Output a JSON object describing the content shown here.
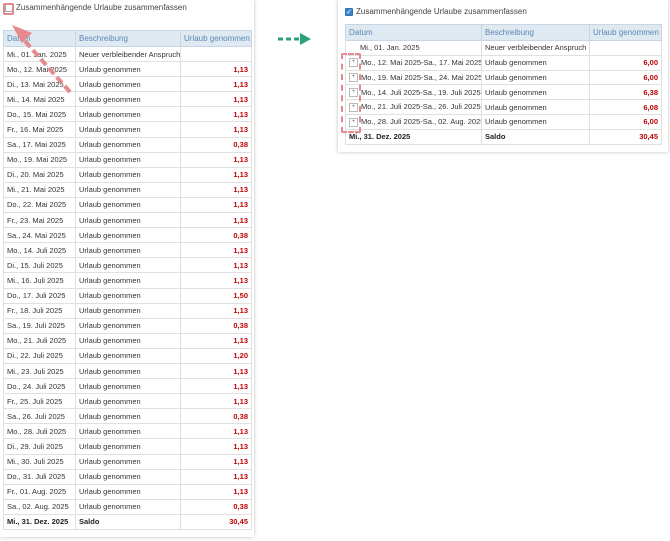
{
  "checkbox_label": "Zusammenhängende Urlaube zusammenfassen",
  "columns": {
    "date": "Datum",
    "description": "Beschreibung",
    "vacation": "Urlaub genommen"
  },
  "left_rows": [
    {
      "date": "Mi., 01. Jan. 2025",
      "desc": "Neuer verbleibender Anspruch",
      "value": ""
    },
    {
      "date": "Mo., 12. Mai 2025",
      "desc": "Urlaub genommen",
      "value": "1,13"
    },
    {
      "date": "Di., 13. Mai 2025",
      "desc": "Urlaub genommen",
      "value": "1,13"
    },
    {
      "date": "Mi., 14. Mai 2025",
      "desc": "Urlaub genommen",
      "value": "1,13"
    },
    {
      "date": "Do., 15. Mai 2025",
      "desc": "Urlaub genommen",
      "value": "1,13"
    },
    {
      "date": "Fr., 16. Mai 2025",
      "desc": "Urlaub genommen",
      "value": "1,13"
    },
    {
      "date": "Sa., 17. Mai 2025",
      "desc": "Urlaub genommen",
      "value": "0,38"
    },
    {
      "date": "Mo., 19. Mai 2025",
      "desc": "Urlaub genommen",
      "value": "1,13"
    },
    {
      "date": "Di., 20. Mai 2025",
      "desc": "Urlaub genommen",
      "value": "1,13"
    },
    {
      "date": "Mi., 21. Mai 2025",
      "desc": "Urlaub genommen",
      "value": "1,13"
    },
    {
      "date": "Do., 22. Mai 2025",
      "desc": "Urlaub genommen",
      "value": "1,13"
    },
    {
      "date": "Fr., 23. Mai 2025",
      "desc": "Urlaub genommen",
      "value": "1,13"
    },
    {
      "date": "Sa., 24. Mai 2025",
      "desc": "Urlaub genommen",
      "value": "0,38"
    },
    {
      "date": "Mo., 14. Juli 2025",
      "desc": "Urlaub genommen",
      "value": "1,13"
    },
    {
      "date": "Di., 15. Juli 2025",
      "desc": "Urlaub genommen",
      "value": "1,13"
    },
    {
      "date": "Mi., 16. Juli 2025",
      "desc": "Urlaub genommen",
      "value": "1,13"
    },
    {
      "date": "Do., 17. Juli 2025",
      "desc": "Urlaub genommen",
      "value": "1,50"
    },
    {
      "date": "Fr., 18. Juli 2025",
      "desc": "Urlaub genommen",
      "value": "1,13"
    },
    {
      "date": "Sa., 19. Juli 2025",
      "desc": "Urlaub genommen",
      "value": "0,38"
    },
    {
      "date": "Mo., 21. Juli 2025",
      "desc": "Urlaub genommen",
      "value": "1,13"
    },
    {
      "date": "Di., 22. Juli 2025",
      "desc": "Urlaub genommen",
      "value": "1,20"
    },
    {
      "date": "Mi., 23. Juli 2025",
      "desc": "Urlaub genommen",
      "value": "1,13"
    },
    {
      "date": "Do., 24. Juli 2025",
      "desc": "Urlaub genommen",
      "value": "1,13"
    },
    {
      "date": "Fr., 25. Juli 2025",
      "desc": "Urlaub genommen",
      "value": "1,13"
    },
    {
      "date": "Sa., 26. Juli 2025",
      "desc": "Urlaub genommen",
      "value": "0,38"
    },
    {
      "date": "Mo., 28. Juli 2025",
      "desc": "Urlaub genommen",
      "value": "1,13"
    },
    {
      "date": "Di., 29. Juli 2025",
      "desc": "Urlaub genommen",
      "value": "1,13"
    },
    {
      "date": "Mi., 30. Juli 2025",
      "desc": "Urlaub genommen",
      "value": "1,13"
    },
    {
      "date": "Do., 31. Juli 2025",
      "desc": "Urlaub genommen",
      "value": "1,13"
    },
    {
      "date": "Fr., 01. Aug. 2025",
      "desc": "Urlaub genommen",
      "value": "1,13"
    },
    {
      "date": "Sa., 02. Aug. 2025",
      "desc": "Urlaub genommen",
      "value": "0,38"
    }
  ],
  "left_total": {
    "date": "Mi., 31. Dez. 2025",
    "desc": "Saldo",
    "value": "30,45"
  },
  "right_rows": [
    {
      "date": "Mi., 01. Jan. 2025",
      "desc": "Neuer verbleibender Anspruch",
      "value": "",
      "expandable": false
    },
    {
      "date": "Mo., 12. Mai 2025-Sa., 17. Mai 2025",
      "desc": "Urlaub genommen",
      "value": "6,00",
      "expandable": true
    },
    {
      "date": "Mo., 19. Mai 2025-Sa., 24. Mai 2025",
      "desc": "Urlaub genommen",
      "value": "6,00",
      "expandable": true
    },
    {
      "date": "Mo., 14. Juli 2025-Sa., 19. Juli 2025",
      "desc": "Urlaub genommen",
      "value": "6,38",
      "expandable": true
    },
    {
      "date": "Mo., 21. Juli 2025-Sa., 26. Juli 2025",
      "desc": "Urlaub genommen",
      "value": "6,08",
      "expandable": true
    },
    {
      "date": "Mo., 28. Juli 2025-Sa., 02. Aug. 2025",
      "desc": "Urlaub genommen",
      "value": "6,00",
      "expandable": true
    }
  ],
  "right_total": {
    "date": "Mi., 31. Dez. 2025",
    "desc": "Saldo",
    "value": "30,45"
  },
  "colors": {
    "highlight": "#e5898f",
    "arrow": "#2aa17a",
    "value_red": "#c00000",
    "header_bg": "#dfe9f2"
  },
  "icons": {
    "expand": "+",
    "check": "✓"
  }
}
